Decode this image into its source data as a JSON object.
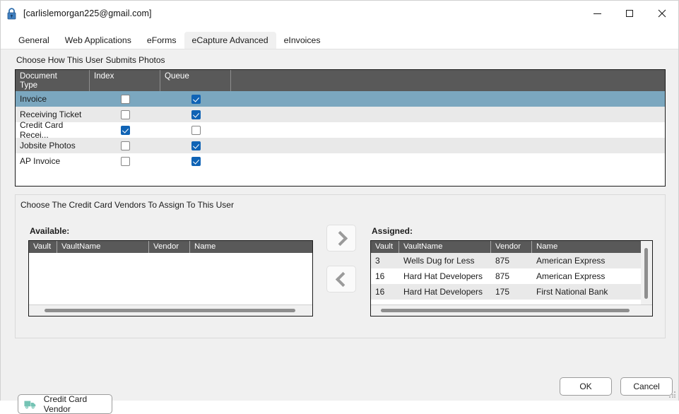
{
  "window": {
    "title": "[carlislemorgan225@gmail.com]",
    "lock_icon": "lock-icon",
    "minimize_label": "Minimize",
    "maximize_label": "Maximize",
    "close_label": "Close"
  },
  "tabs": [
    {
      "label": "General",
      "active": false
    },
    {
      "label": "Web Applications",
      "active": false
    },
    {
      "label": "eForms",
      "active": false
    },
    {
      "label": "eCapture Advanced",
      "active": true
    },
    {
      "label": "eInvoices",
      "active": false
    }
  ],
  "photos_section": {
    "label": "Choose How This User Submits Photos",
    "columns": [
      "Document\nType",
      "Index",
      "Queue",
      ""
    ],
    "column_header_line1": "Document",
    "column_header_line2": "Type",
    "column_index": "Index",
    "column_queue": "Queue",
    "rows": [
      {
        "document_type": "Invoice",
        "index": false,
        "queue": true,
        "selected": true
      },
      {
        "document_type": "Receiving Ticket",
        "index": false,
        "queue": true,
        "selected": false
      },
      {
        "document_type": "Credit Card Recei...",
        "index": true,
        "queue": false,
        "selected": false
      },
      {
        "document_type": "Jobsite Photos",
        "index": false,
        "queue": true,
        "selected": false
      },
      {
        "document_type": "AP Invoice",
        "index": false,
        "queue": true,
        "selected": false
      }
    ]
  },
  "vendors_section": {
    "label": "Choose The Credit Card Vendors To Assign To This User",
    "available_title": "Available:",
    "assigned_title": "Assigned:",
    "columns": [
      "Vault",
      "VaultName",
      "Vendor",
      "Name"
    ],
    "available_rows": [],
    "assigned_rows": [
      {
        "vault": "3",
        "vault_name": "Wells Dug for Less",
        "vendor": "875",
        "name": "American Express"
      },
      {
        "vault": "16",
        "vault_name": "Hard Hat Developers",
        "vendor": "875",
        "name": "American Express"
      },
      {
        "vault": "16",
        "vault_name": "Hard Hat Developers",
        "vendor": "175",
        "name": "First National Bank"
      }
    ],
    "assign_button": "move-right",
    "unassign_button": "move-left"
  },
  "credit_card_vendor_button": {
    "label": "Credit Card Vendor",
    "icon": "truck-icon",
    "icon_color": "#74c3b4"
  },
  "footer": {
    "ok_label": "OK",
    "cancel_label": "Cancel"
  },
  "colors": {
    "selected_row": "#7ba7bf",
    "header_bg": "#595959",
    "checkbox_checked": "#0f63b5",
    "window_bg": "#f0f0f0"
  }
}
